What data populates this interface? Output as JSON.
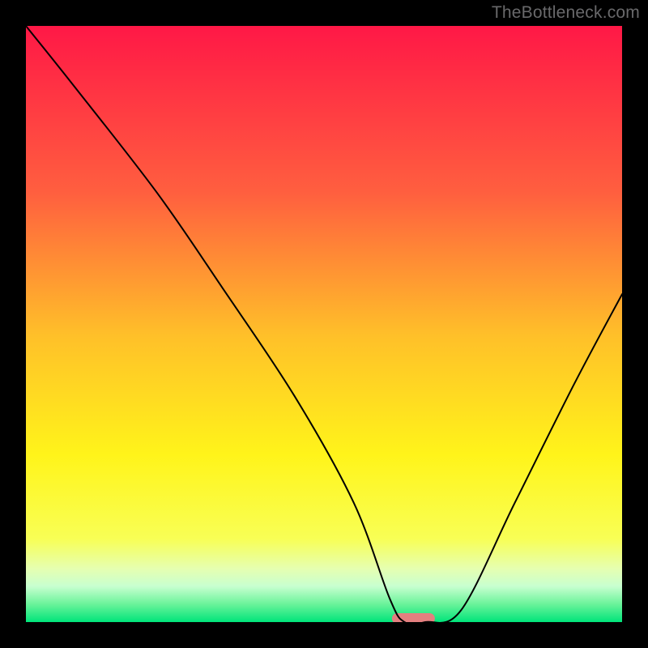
{
  "watermark": "TheBottleneck.com",
  "chart_data": {
    "type": "line",
    "title": "",
    "xlabel": "",
    "ylabel": "",
    "xlim": [
      0,
      100
    ],
    "ylim": [
      0,
      100
    ],
    "grid": false,
    "legend": false,
    "background_gradient_stops": [
      {
        "offset": 0,
        "color": "#ff1846"
      },
      {
        "offset": 28,
        "color": "#ff5f3f"
      },
      {
        "offset": 52,
        "color": "#ffc029"
      },
      {
        "offset": 72,
        "color": "#fff41a"
      },
      {
        "offset": 86,
        "color": "#f8ff55"
      },
      {
        "offset": 91,
        "color": "#e6ffb0"
      },
      {
        "offset": 94,
        "color": "#c8ffd0"
      },
      {
        "offset": 97,
        "color": "#6af39a"
      },
      {
        "offset": 100,
        "color": "#00e47a"
      }
    ],
    "series": [
      {
        "name": "curve",
        "stroke": "#000000",
        "stroke_width": 2,
        "x": [
          0,
          8,
          22,
          33,
          45,
          55,
          61,
          63.5,
          67,
          73,
          82,
          92,
          100
        ],
        "y": [
          100,
          90,
          72,
          56,
          38,
          20,
          4,
          0,
          0,
          2,
          20,
          40,
          55
        ]
      }
    ],
    "markers": [
      {
        "name": "highlight-pill",
        "shape": "pill",
        "cx": 65,
        "cy": 0.6,
        "rx": 3.6,
        "ry": 0.9,
        "fill": "#e37f7f"
      }
    ]
  }
}
